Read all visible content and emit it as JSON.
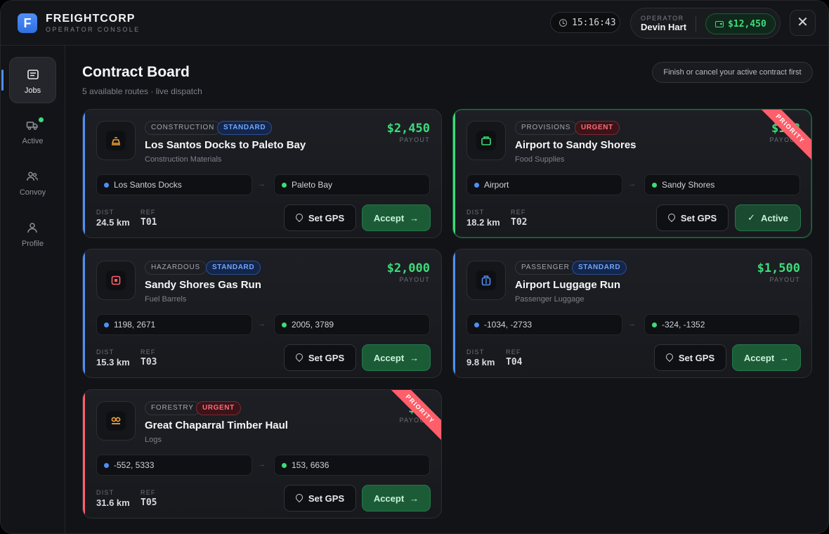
{
  "brand": {
    "logo_letter": "F",
    "title": "FREIGHTCORP",
    "subtitle": "OPERATOR CONSOLE"
  },
  "header": {
    "time": "15:16:43",
    "operator_label": "OPERATOR",
    "operator_name": "Devin Hart",
    "balance": "$12,450",
    "close_symbol": "✕"
  },
  "sidebar": {
    "items": [
      {
        "label": "Jobs",
        "icon": "jobs-icon",
        "active": true
      },
      {
        "label": "Active",
        "icon": "truck-icon",
        "active": false,
        "indicator": true
      },
      {
        "label": "Convoy",
        "icon": "convoy-icon",
        "active": false
      },
      {
        "label": "Profile",
        "icon": "profile-icon",
        "active": false
      }
    ]
  },
  "main": {
    "title": "Contract Board",
    "subtitle": "5 available routes · live dispatch",
    "notice": "Finish or cancel your active contract first"
  },
  "labels": {
    "payout": "PAYOUT",
    "dist": "DIST",
    "ref": "REF",
    "set_gps": "Set GPS",
    "accept": "Accept",
    "active": "Active",
    "priority": "PRIORITY"
  },
  "colors": {
    "accent_blue": "#4f8ff7",
    "accent_green": "#3ddc7a",
    "accent_red": "#ff5f6b"
  },
  "contracts": [
    {
      "category": "CONSTRUCTION",
      "priority": "STANDARD",
      "title": "Los Santos Docks to Paleto Bay",
      "cargo": "Construction Materials",
      "payout": "$2,450",
      "from": "Los Santos Docks",
      "to": "Paleto Bay",
      "dist": "24.5 km",
      "ref": "T01",
      "action": "Accept",
      "ribbon": false,
      "icon": "construction-icon"
    },
    {
      "category": "PROVISIONS",
      "priority": "URGENT",
      "title": "Airport to Sandy Shores",
      "cargo": "Food Supplies",
      "payout": "$1,8",
      "from": "Airport",
      "to": "Sandy Shores",
      "dist": "18.2 km",
      "ref": "T02",
      "action": "Active",
      "ribbon": true,
      "icon": "provisions-icon"
    },
    {
      "category": "HAZARDOUS",
      "priority": "STANDARD",
      "title": "Sandy Shores Gas Run",
      "cargo": "Fuel Barrels",
      "payout": "$2,000",
      "from": "1198, 2671",
      "to": "2005, 3789",
      "dist": "15.3 km",
      "ref": "T03",
      "action": "Accept",
      "ribbon": false,
      "icon": "hazard-icon"
    },
    {
      "category": "PASSENGER",
      "priority": "STANDARD",
      "title": "Airport Luggage Run",
      "cargo": "Passenger Luggage",
      "payout": "$1,500",
      "from": "-1034, -2733",
      "to": "-324, -1352",
      "dist": "9.8 km",
      "ref": "T04",
      "action": "Accept",
      "ribbon": false,
      "icon": "luggage-icon"
    },
    {
      "category": "FORESTRY",
      "priority": "URGENT",
      "title": "Great Chaparral Timber Haul",
      "cargo": "Logs",
      "payout": "$3,",
      "from": "-552, 5333",
      "to": "153, 6636",
      "dist": "31.6 km",
      "ref": "T05",
      "action": "Accept",
      "ribbon": true,
      "icon": "timber-icon"
    }
  ]
}
